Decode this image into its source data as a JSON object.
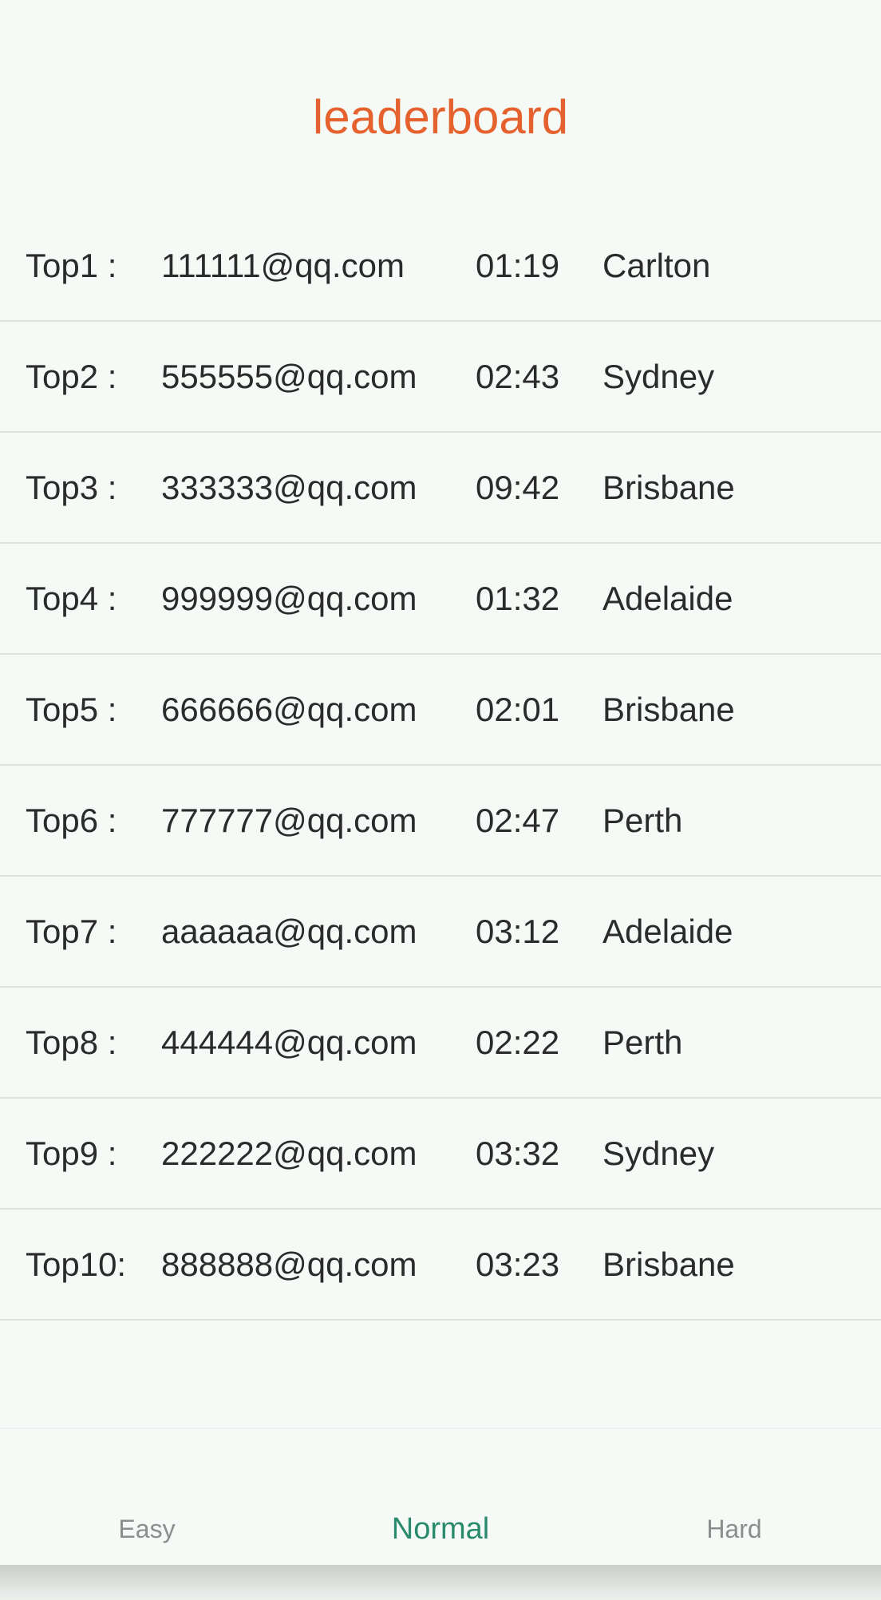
{
  "header": {
    "title": "leaderboard"
  },
  "leaderboard": [
    {
      "rank": "Top1  :",
      "email": "111111@qq.com",
      "time": "01:19",
      "city": "Carlton"
    },
    {
      "rank": "Top2  :",
      "email": "555555@qq.com",
      "time": "02:43",
      "city": "Sydney"
    },
    {
      "rank": "Top3  :",
      "email": "333333@qq.com",
      "time": "09:42",
      "city": "Brisbane"
    },
    {
      "rank": "Top4  :",
      "email": "999999@qq.com",
      "time": "01:32",
      "city": "Adelaide"
    },
    {
      "rank": "Top5  :",
      "email": "666666@qq.com",
      "time": "02:01",
      "city": "Brisbane"
    },
    {
      "rank": "Top6  :",
      "email": "777777@qq.com",
      "time": "02:47",
      "city": "Perth"
    },
    {
      "rank": "Top7  :",
      "email": "aaaaaa@qq.com",
      "time": "03:12",
      "city": "Adelaide"
    },
    {
      "rank": "Top8  :",
      "email": "444444@qq.com",
      "time": "02:22",
      "city": "Perth"
    },
    {
      "rank": "Top9  :",
      "email": "222222@qq.com",
      "time": "03:32",
      "city": "Sydney"
    },
    {
      "rank": "Top10:",
      "email": "888888@qq.com",
      "time": "03:23",
      "city": "Brisbane"
    }
  ],
  "nav": {
    "tabs": [
      {
        "label": "Easy",
        "active": false
      },
      {
        "label": "Normal",
        "active": true
      },
      {
        "label": "Hard",
        "active": false
      }
    ],
    "active_color": "#2a8a6e"
  },
  "colors": {
    "title": "#e5622f"
  }
}
